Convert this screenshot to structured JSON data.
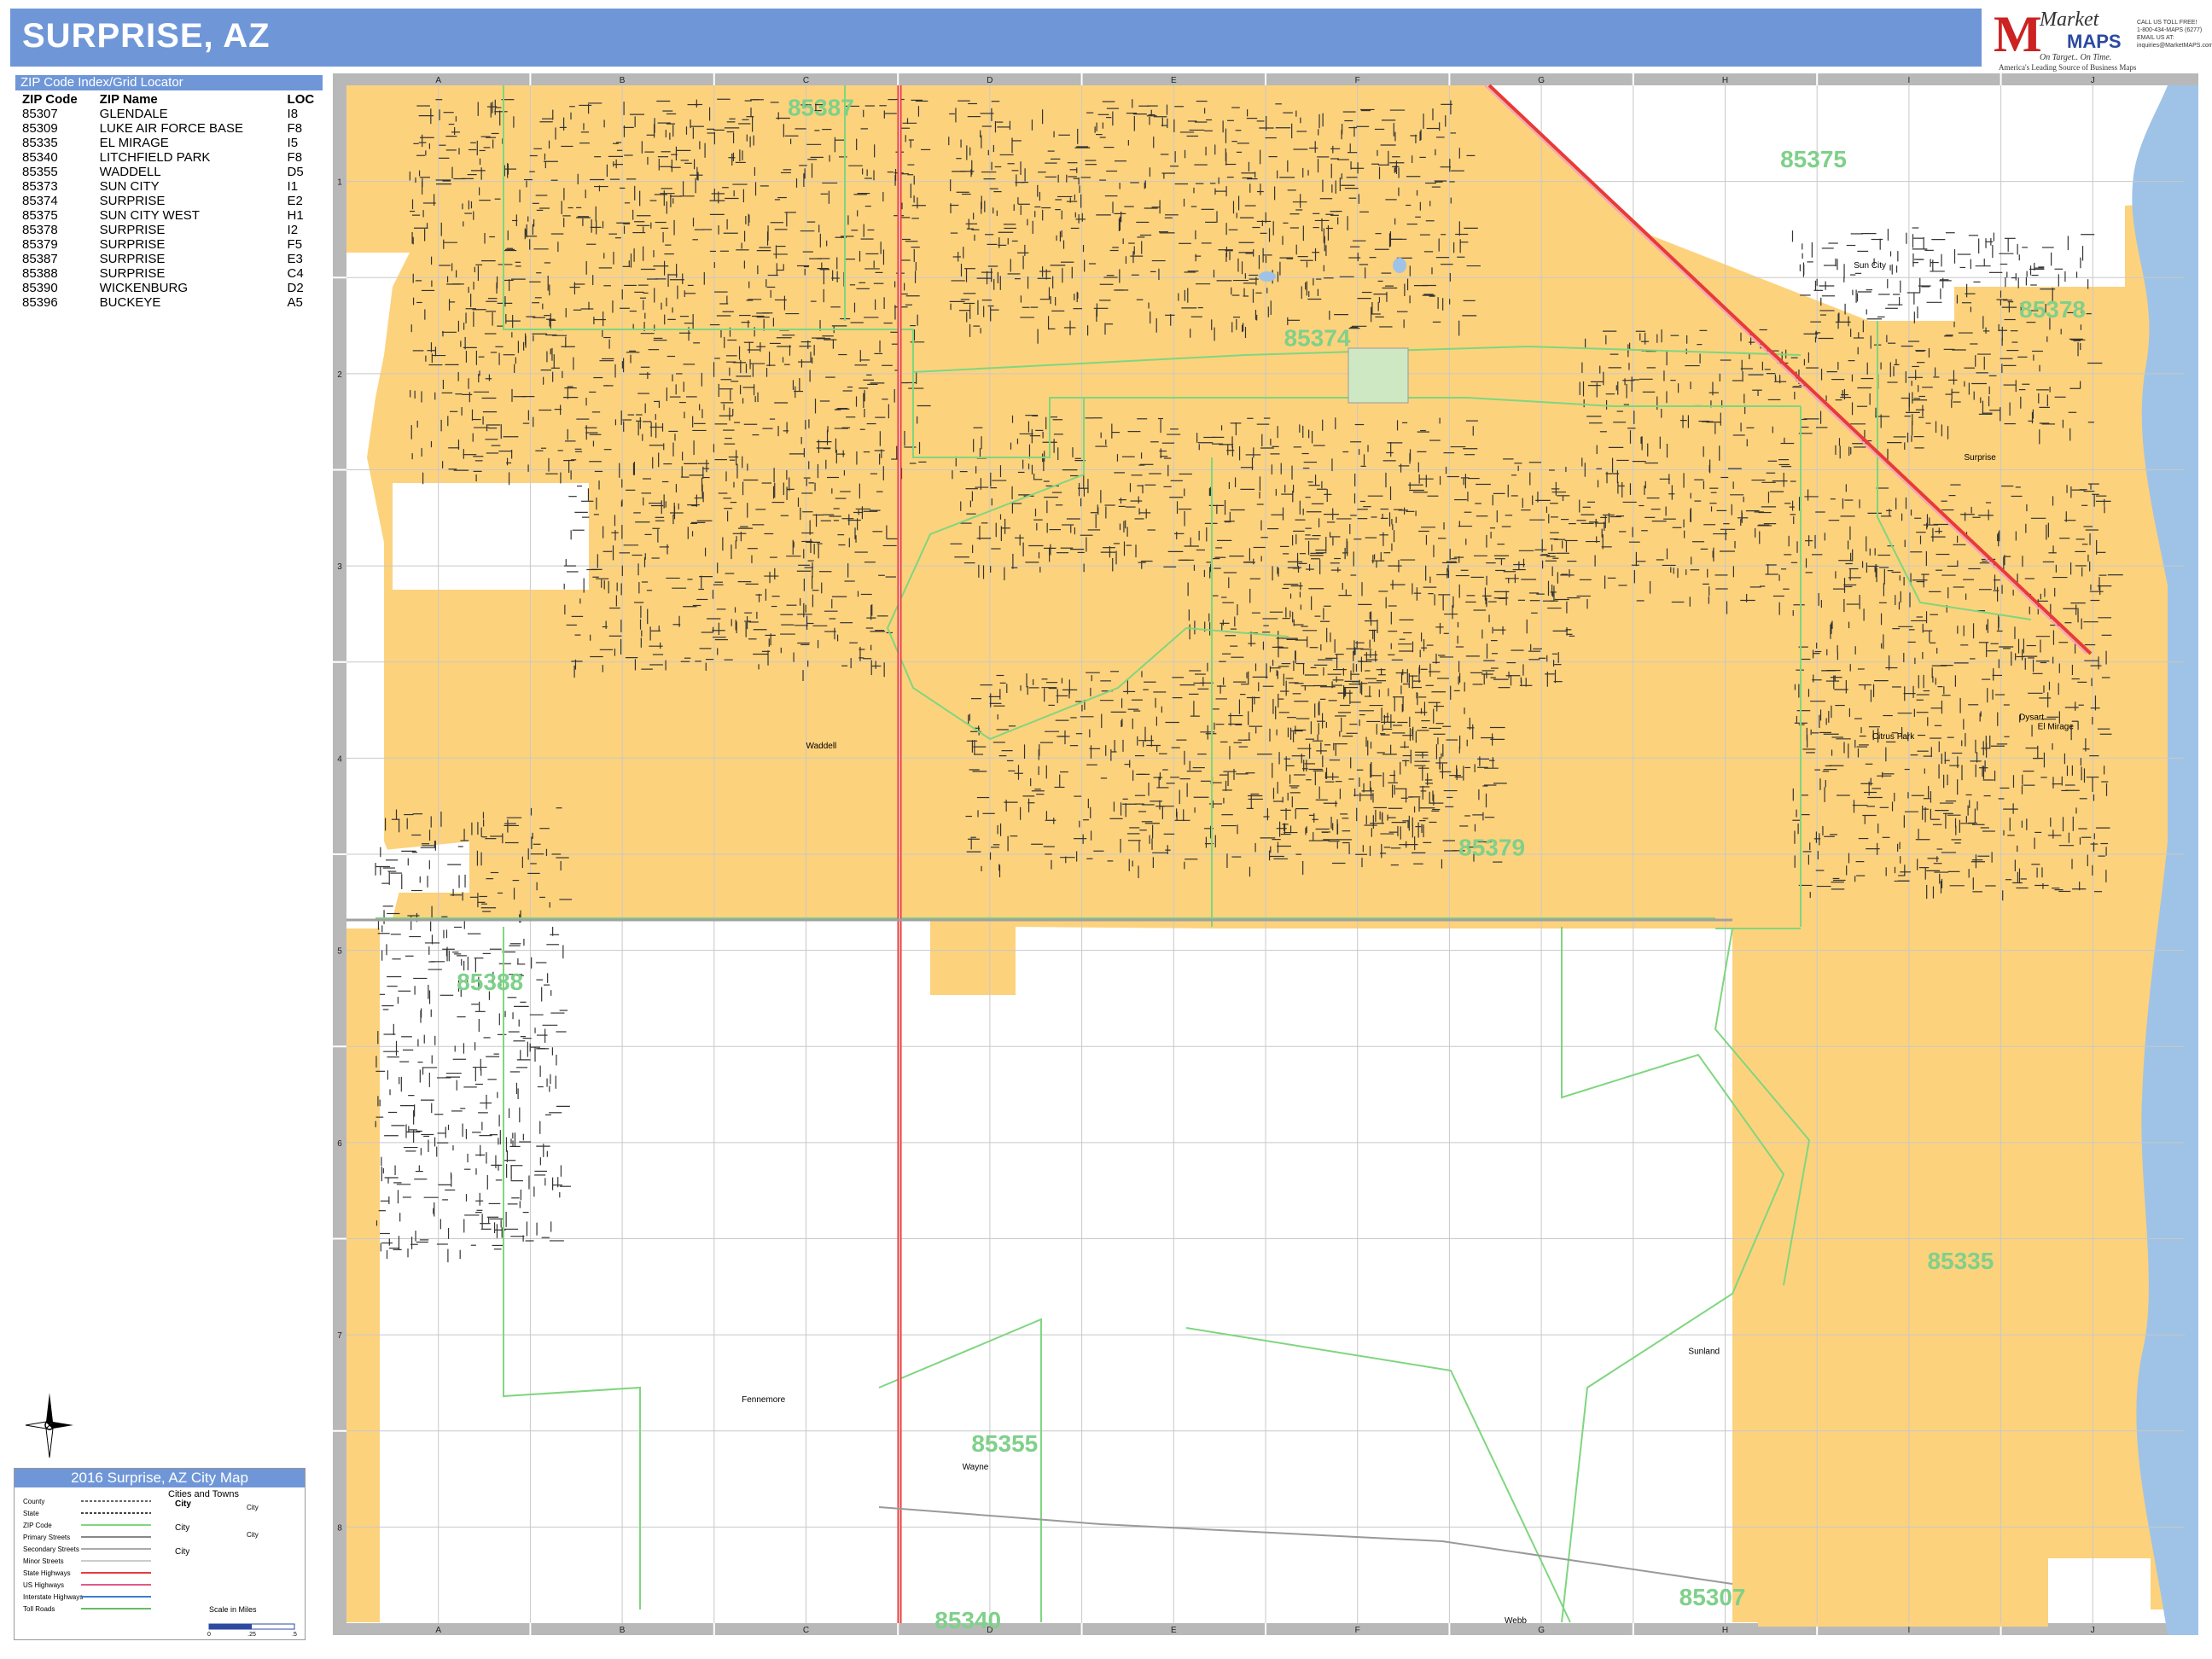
{
  "title": "SURPRISE, AZ",
  "logo": {
    "brand_market": "Market",
    "brand_maps": "MAPS",
    "tagline": "On Target.. On Time.",
    "subtag": "America's Leading Source of Business Maps",
    "contact_lines": [
      "CALL US TOLL FREE!",
      "1-800-434-MAPS (6277)",
      "EMAIL US AT:",
      "inquiries@MarketMAPS.com"
    ]
  },
  "zip_index": {
    "header": "ZIP Code Index/Grid Locator",
    "columns": [
      "ZIP Code",
      "ZIP Name",
      "LOC"
    ],
    "rows": [
      [
        "85307",
        "GLENDALE",
        "I8"
      ],
      [
        "85309",
        "LUKE AIR FORCE BASE",
        "F8"
      ],
      [
        "85335",
        "EL MIRAGE",
        "I5"
      ],
      [
        "85340",
        "LITCHFIELD PARK",
        "F8"
      ],
      [
        "85355",
        "WADDELL",
        "D5"
      ],
      [
        "85373",
        "SUN CITY",
        "I1"
      ],
      [
        "85374",
        "SURPRISE",
        "E2"
      ],
      [
        "85375",
        "SUN CITY WEST",
        "H1"
      ],
      [
        "85378",
        "SURPRISE",
        "I2"
      ],
      [
        "85379",
        "SURPRISE",
        "F5"
      ],
      [
        "85387",
        "SURPRISE",
        "E3"
      ],
      [
        "85388",
        "SURPRISE",
        "C4"
      ],
      [
        "85390",
        "WICKENBURG",
        "D2"
      ],
      [
        "85396",
        "BUCKEYE",
        "A5"
      ]
    ]
  },
  "grid": {
    "columns": [
      "A",
      "B",
      "C",
      "D",
      "E",
      "F",
      "G",
      "H",
      "I",
      "J"
    ],
    "rows": [
      "1",
      "2",
      "3",
      "4",
      "5",
      "6",
      "7",
      "8"
    ]
  },
  "zip_labels": [
    {
      "text": "85387",
      "col": 2.4,
      "row": 0.05
    },
    {
      "text": "85375",
      "col": 7.8,
      "row": 0.32
    },
    {
      "text": "85374",
      "col": 5.1,
      "row": 1.25
    },
    {
      "text": "85378",
      "col": 9.1,
      "row": 1.1
    },
    {
      "text": "85379",
      "col": 6.05,
      "row": 3.9
    },
    {
      "text": "85388",
      "col": 0.6,
      "row": 4.6
    },
    {
      "text": "85335",
      "col": 8.6,
      "row": 6.05
    },
    {
      "text": "85355",
      "col": 3.4,
      "row": 7.0
    },
    {
      "text": "85340",
      "col": 3.2,
      "row": 7.92
    },
    {
      "text": "85307",
      "col": 7.25,
      "row": 7.8
    }
  ],
  "place_labels": [
    {
      "text": "Waddell",
      "col": 2.5,
      "row": 3.45
    },
    {
      "text": "Surprise",
      "col": 8.8,
      "row": 1.95
    },
    {
      "text": "El Mirage",
      "col": 9.2,
      "row": 3.35
    },
    {
      "text": "Dysart",
      "col": 9.1,
      "row": 3.3
    },
    {
      "text": "Sun City",
      "col": 8.2,
      "row": 0.95
    },
    {
      "text": "Citrus Park",
      "col": 8.3,
      "row": 3.4
    },
    {
      "text": "Wayne",
      "col": 3.35,
      "row": 7.2
    },
    {
      "text": "Fennemore",
      "col": 2.15,
      "row": 6.85
    },
    {
      "text": "Sunland",
      "col": 7.3,
      "row": 6.6
    },
    {
      "text": "Webb",
      "col": 6.3,
      "row": 8.0
    }
  ],
  "legend": {
    "title": "2016 Surprise, AZ City Map",
    "cities_header": "Cities and Towns",
    "items": [
      "County",
      "State",
      "ZIP Code",
      "Primary Streets",
      "Secondary Streets",
      "Minor Streets",
      "State Highways",
      "US Highways",
      "Interstate Highways",
      "Toll Roads"
    ],
    "city_marker": "City",
    "scale_label": "Scale in Miles",
    "scale_ticks": [
      "0",
      ".25",
      ".5"
    ]
  },
  "colors": {
    "city_fill": "#fdd27d",
    "zip_line": "#7fd67f",
    "water": "#9fc3e6",
    "highway": "#e83a3a",
    "frame": "#b8b8b8",
    "zip_label": "#7fd08a",
    "header": "#6f97d8"
  }
}
